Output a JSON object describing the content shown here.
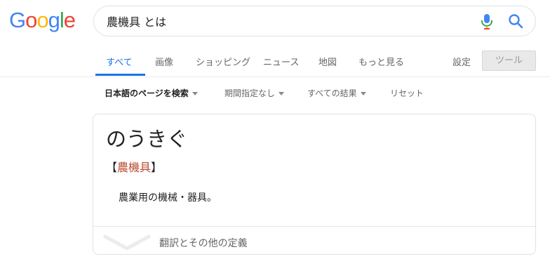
{
  "logo": {
    "letters": [
      "G",
      "o",
      "o",
      "g",
      "l",
      "e"
    ],
    "colors": [
      "#4285f4",
      "#ea4335",
      "#fbbc05",
      "#4285f4",
      "#34a853",
      "#ea4335"
    ]
  },
  "search": {
    "query": "農機具 とは"
  },
  "tabs": [
    {
      "label": "すべて",
      "active": true
    },
    {
      "label": "画像"
    },
    {
      "label": "ショッピング"
    },
    {
      "label": "ニュース"
    },
    {
      "label": "地図"
    },
    {
      "label": "もっと見る"
    }
  ],
  "settings_label": "設定",
  "tools_label": "ツール",
  "filters": [
    {
      "label": "日本語のページを検索"
    },
    {
      "label": "期間指定なし"
    },
    {
      "label": "すべての結果"
    },
    {
      "label": "リセット"
    }
  ],
  "result": {
    "headword": "のうきぐ",
    "bracket_open": "【",
    "kanji": "農機具",
    "bracket_close": "】",
    "definition": "農業用の機械・器具。",
    "more_definitions": "翻訳とその他の定義"
  },
  "colors": {
    "accent": "#1a73e8",
    "kanji_link": "#b94a2f"
  }
}
